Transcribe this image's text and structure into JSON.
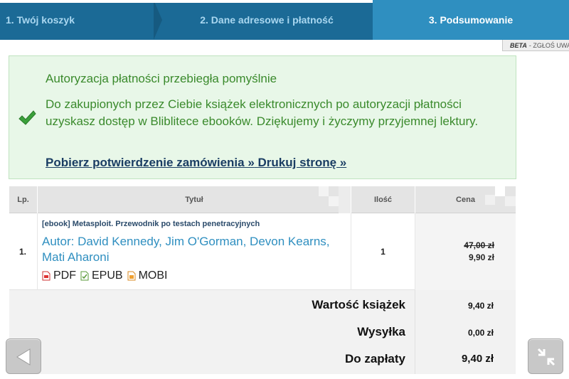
{
  "steps": [
    {
      "label": "1. Twój koszyk",
      "state": "done"
    },
    {
      "label": "2. Dane adresowe i płatność",
      "state": "done"
    },
    {
      "label": "3. Podsumowanie",
      "state": "active"
    }
  ],
  "beta_banner": {
    "badge": "BETA",
    "text": "- ZGŁOŚ UWAGI"
  },
  "success": {
    "title": "Autoryzacja płatności przebiegła pomyślnie",
    "message": "Do zakupionych przez Ciebie książek elektronicznych po autoryzacji płatności uzyskasz dostęp w Bliblitece ebooków. Dziękujemy i życzymy przyjemnej lektury.",
    "download_link": "Pobierz potwierdzenie zamówienia »",
    "print_link": "Drukuj stronę »"
  },
  "table": {
    "headers": {
      "lp": "Lp.",
      "title": "Tytuł",
      "qty": "Ilość",
      "price": "Cena"
    },
    "rows": [
      {
        "lp": "1.",
        "tag": "[ebook] Metasploit. Przewodnik po testach penetracyjnych",
        "authors": "Autor: David Kennedy, Jim O'Gorman, Devon Kearns, Mati Aharoni",
        "formats": [
          "PDF",
          "EPUB",
          "MOBI"
        ],
        "qty": "1",
        "old_price": "47,00 zł",
        "price": "9,90 zł"
      }
    ]
  },
  "summary": {
    "books_label": "Wartość książek",
    "books_value": "9,40 zł",
    "shipping_label": "Wysyłka",
    "shipping_value": "0,00 zł",
    "total_label": "Do zapłaty",
    "total_value": "9,40 zł"
  },
  "colors": {
    "accent": "#2f8fc0",
    "success_text": "#3a8a2c",
    "success_bg": "#e8f7e8"
  },
  "icons": {
    "check": "check-icon",
    "back": "arrow-left-icon",
    "exit_fullscreen": "collapse-icon",
    "pdf": "pdf-icon",
    "epub": "epub-icon",
    "mobi": "mobi-icon"
  }
}
